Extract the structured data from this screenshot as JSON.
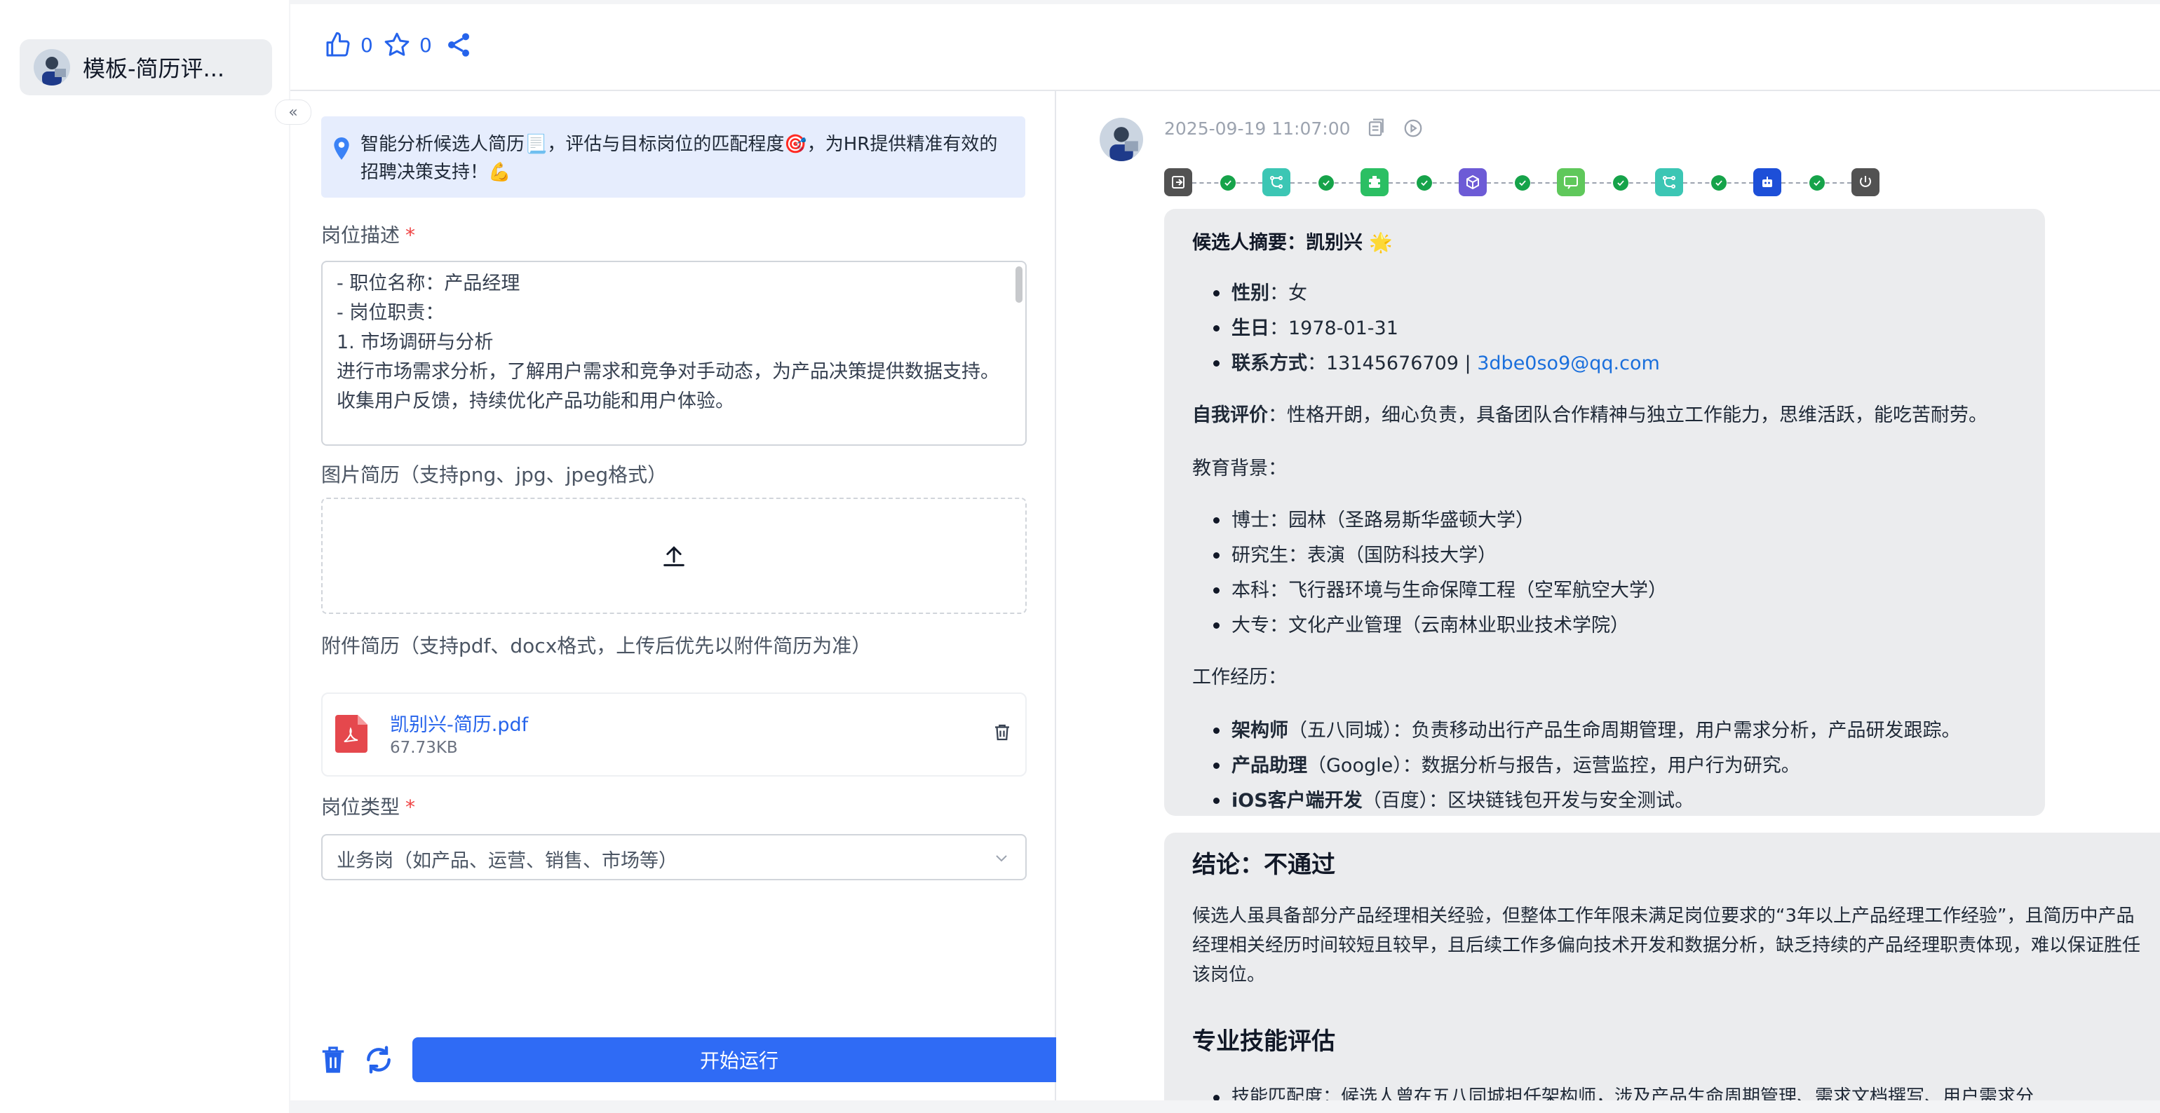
{
  "sidebar": {
    "item_label": "模板-简历评..."
  },
  "toolbar": {
    "like_count": "0",
    "star_count": "0"
  },
  "form": {
    "intro_text": "智能分析候选人简历📃，评估与目标岗位的匹配程度🎯，为HR提供精准有效的招聘决策支持！💪",
    "job_desc_label": "岗位描述",
    "required_mark": "*",
    "job_desc_text": "- 职位名称：产品经理\n- 岗位职责：\n1. 市场调研与分析\n进行市场需求分析，了解用户需求和竞争对手动态，为产品决策提供数据支持。\n收集用户反馈，持续优化产品功能和用户体验。",
    "image_resume_label": "图片简历（支持png、jpg、jpeg格式）",
    "attachment_label": "附件简历（支持pdf、docx格式，上传后优先以附件简历为准）",
    "file_name": "凯别兴-简历.pdf",
    "file_size": "67.73KB",
    "job_type_label": "岗位类型",
    "job_type_value": "业务岗（如产品、运营、销售、市场等）",
    "run_button": "开始运行"
  },
  "message": {
    "timestamp": "2025-09-19 11:07:00",
    "summary_title": "候选人摘要：凯别兴 🌟",
    "gender_label": "性别",
    "gender_value": "：女",
    "birth_label": "生日",
    "birth_value": "：1978-01-31",
    "contact_label": "联系方式",
    "contact_value": "：13145676709 | ",
    "email": "3dbe0so9@qq.com",
    "self_eval_label": "自我评价",
    "self_eval_value": "：性格开朗，细心负责，具备团队合作精神与独立工作能力，思维活跃，能吃苦耐劳。",
    "education_title": "教育背景：",
    "education": [
      "博士：园林（圣路易斯华盛顿大学）",
      "研究生：表演（国防科技大学）",
      "本科：飞行器环境与生命保障工程（空军航空大学）",
      "大专：文化产业管理（云南林业职业技术学院）"
    ],
    "work_title": "工作经历：",
    "work": [
      {
        "role": "架构师",
        "detail": "（五八同城）：负责移动出行产品生命周期管理，用户需求分析，产品研发跟踪。"
      },
      {
        "role": "产品助理",
        "detail": "（Google）：数据分析与报告，运营监控，用户行为研究。"
      },
      {
        "role": "iOS客户端开发",
        "detail": "（百度）：区块链钱包开发与安全测试。"
      }
    ],
    "conclusion_title": "结论：不通过",
    "conclusion_text": "候选人虽具备部分产品经理相关经验，但整体工作年限未满足岗位要求的“3年以上产品经理工作经验”，且简历中产品经理相关经历时间较短且较早，且后续工作多偏向技术开发和数据分析，缺乏持续的产品经理职责体现，难以保证胜任该岗位。",
    "skills_title": "专业技能评估",
    "skills_line": "技能匹配度：候选人曾在五八同城担任架构师，涉及产品生命周期管理、需求文档撰写、用户需求分"
  },
  "workflow_colors": [
    "#525252",
    "#3cc6b4",
    "#2bbf63",
    "#6d5bd6",
    "#5fc85b",
    "#3cc6b4",
    "#1d4fd8",
    "#525252"
  ]
}
